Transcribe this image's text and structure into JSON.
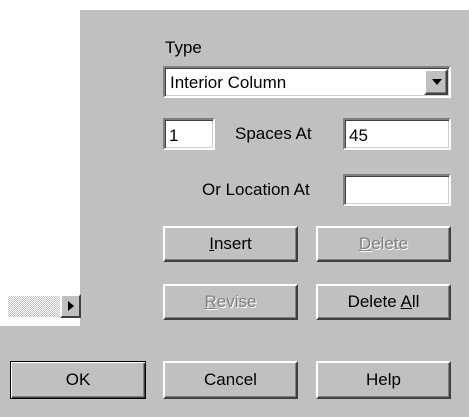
{
  "type_label": "Type",
  "type_select": {
    "value": "Interior Column"
  },
  "count_field": {
    "value": "1"
  },
  "spaces_at_label": "Spaces At",
  "spaces_field": {
    "value": "45"
  },
  "location_label": "Or Location At",
  "location_field": {
    "value": ""
  },
  "buttons": {
    "insert": {
      "pre": "",
      "key": "I",
      "post": "nsert"
    },
    "delete": {
      "pre": "",
      "key": "D",
      "post": "elete"
    },
    "revise": {
      "pre": "",
      "key": "R",
      "post": "evise"
    },
    "delete_all": {
      "pre": "Delete ",
      "key": "A",
      "post": "ll"
    },
    "ok": "OK",
    "cancel": "Cancel",
    "help": "Help"
  },
  "icons": {
    "dropdown": "chevron-down-icon",
    "scroll": "arrow-right-icon"
  }
}
